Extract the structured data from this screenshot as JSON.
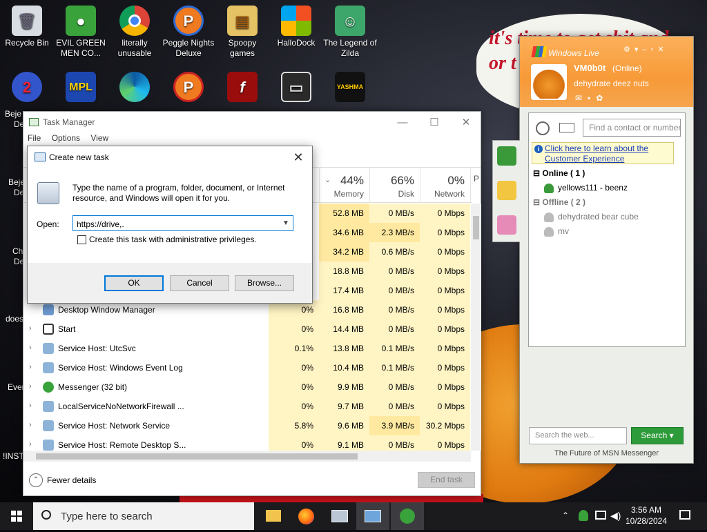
{
  "desktop": {
    "icons": [
      {
        "label": "Recycle Bin",
        "glyph": "🗑",
        "color": "#d8dde3"
      },
      {
        "label": "EVIL GREEN MEN CO...",
        "glyph": "●",
        "color": "#39a23a"
      },
      {
        "label": "literally unusable",
        "glyph": "◉",
        "color": "#e8e8e8"
      },
      {
        "label": "Peggle Nights Deluxe",
        "glyph": "P",
        "color": "#f07a20"
      },
      {
        "label": "Spoopy games",
        "glyph": "▤",
        "color": "#e5c264"
      },
      {
        "label": "HalloDock",
        "glyph": "⛨",
        "color": "#4a8fd6"
      },
      {
        "label": "The Legend of Zilda",
        "glyph": "☺",
        "color": "#3da66a"
      }
    ],
    "partial_labels": [
      "Beje",
      "Bejev",
      "De",
      "De",
      "Ch",
      "De",
      "does",
      "Ever",
      "!INSTA"
    ],
    "wallpaper_text": "it's time to get shit and\nor t"
  },
  "task_manager": {
    "title": "Task Manager",
    "menu": [
      "File",
      "Options",
      "View"
    ],
    "columns": [
      {
        "pct": "44%",
        "label": "Memory"
      },
      {
        "pct": "66%",
        "label": "Disk"
      },
      {
        "pct": "0%",
        "label": "Network"
      },
      {
        "pct": "",
        "label": "P"
      }
    ],
    "rows": [
      {
        "name": "",
        "cpu": "",
        "memory": "52.8 MB",
        "disk": "0 MB/s",
        "network": "0 Mbps"
      },
      {
        "name": "",
        "cpu": "",
        "memory": "34.6 MB",
        "disk": "2.3 MB/s",
        "network": "0 Mbps"
      },
      {
        "name": "",
        "cpu": "",
        "memory": "34.2 MB",
        "disk": "0.6 MB/s",
        "network": "0 Mbps"
      },
      {
        "name": "",
        "cpu": "",
        "memory": "18.8 MB",
        "disk": "0 MB/s",
        "network": "0 Mbps"
      },
      {
        "name": "",
        "cpu": "",
        "memory": "17.4 MB",
        "disk": "0 MB/s",
        "network": "0 Mbps"
      },
      {
        "name": "Desktop Window Manager",
        "cpu": "0%",
        "memory": "16.8 MB",
        "disk": "0 MB/s",
        "network": "0 Mbps"
      },
      {
        "name": "Start",
        "cpu": "0%",
        "memory": "14.4 MB",
        "disk": "0 MB/s",
        "network": "0 Mbps"
      },
      {
        "name": "Service Host: UtcSvc",
        "cpu": "0.1%",
        "memory": "13.8 MB",
        "disk": "0.1 MB/s",
        "network": "0 Mbps"
      },
      {
        "name": "Service Host: Windows Event Log",
        "cpu": "0%",
        "memory": "10.4 MB",
        "disk": "0.1 MB/s",
        "network": "0 Mbps"
      },
      {
        "name": "Messenger (32 bit)",
        "cpu": "0%",
        "memory": "9.9 MB",
        "disk": "0 MB/s",
        "network": "0 Mbps"
      },
      {
        "name": "LocalServiceNoNetworkFirewall ...",
        "cpu": "0%",
        "memory": "9.7 MB",
        "disk": "0 MB/s",
        "network": "0 Mbps"
      },
      {
        "name": "Service Host: Network Service",
        "cpu": "5.8%",
        "memory": "9.6 MB",
        "disk": "3.9 MB/s",
        "network": "30.2 Mbps"
      },
      {
        "name": "Service Host: Remote Desktop S...",
        "cpu": "0%",
        "memory": "9.1 MB",
        "disk": "0 MB/s",
        "network": "0 Mbps"
      }
    ],
    "fewer_details": "Fewer details",
    "end_task": "End task"
  },
  "run_dialog": {
    "title": "Create new task",
    "description": "Type the name of a program, folder, document, or Internet resource, and Windows will open it for you.",
    "open_label": "Open:",
    "open_value": "https://drive,.",
    "admin_checkbox_label": "Create this task with administrative privileges.",
    "ok": "OK",
    "cancel": "Cancel",
    "browse": "Browse..."
  },
  "messenger": {
    "app_name": "Windows Live",
    "username": "VM0b0t",
    "status": "(Online)",
    "personal_message": "dehydrate deez nuts",
    "find_placeholder": "Find a contact or number",
    "info_link": "Click here to learn about the Customer Experience",
    "online_group": "Online ( 1 )",
    "online_contacts": [
      "yellows111 - beenz"
    ],
    "offline_group": "Offline ( 2 )",
    "offline_contacts": [
      "dehydrated bear cube",
      "mv"
    ],
    "search_placeholder": "Search the web...",
    "search_button": "Search",
    "footer": "The Future of MSN Messenger"
  },
  "taskbar": {
    "search_placeholder": "Type here to search",
    "time": "3:56 AM",
    "date": "10/28/2024"
  },
  "colors": {
    "accent_blue": "#0078d7",
    "wlm_orange": "#f79a38",
    "wlm_green": "#2e9b3b",
    "tm_highlight": "#fff4c4"
  }
}
